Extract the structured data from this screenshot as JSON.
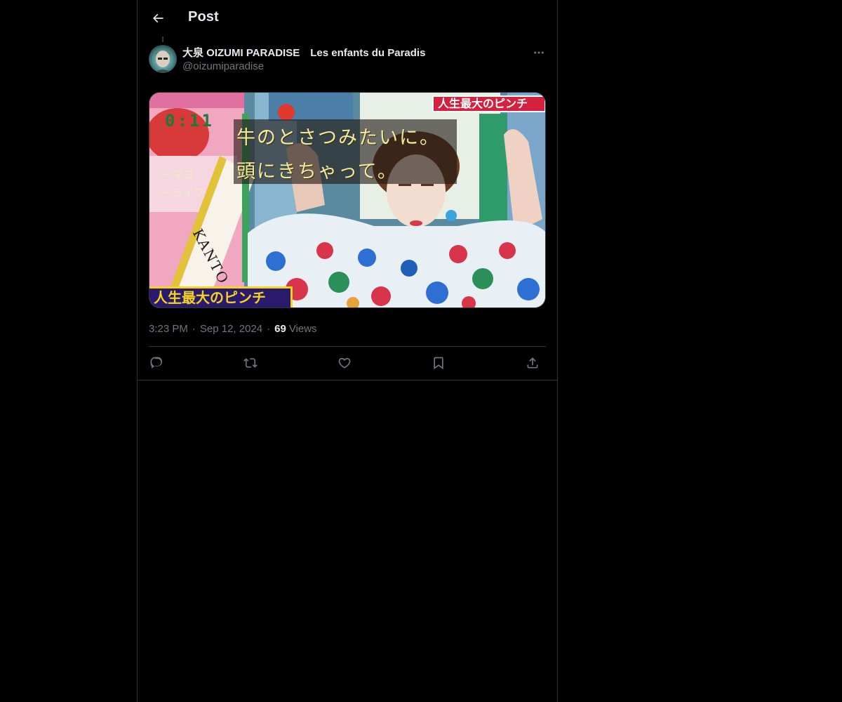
{
  "header": {
    "title": "Post",
    "back_icon": "arrow-left-icon"
  },
  "post": {
    "author": {
      "display_name": "大泉 OIZUMI PARADISE　Les enfants du Paradis",
      "handle": "@oizumiparadise",
      "avatar_icon": "avatar-photo"
    },
    "more_icon": "ellipsis-icon",
    "media": {
      "timer": "0:11",
      "caption_lines": [
        "牛のとさつみたいに。",
        "頭にきちゃって。"
      ],
      "banner_top": "人生最大のピンチ",
      "banner_bottom": "人生最大のピンチ",
      "side_labels": [
        "ーマヨ",
        "ーライフ"
      ],
      "sash_text": "KANTO"
    },
    "time": "3:23 PM",
    "separator": "·",
    "date": "Sep 12, 2024",
    "views_count": "69",
    "views_label": "Views"
  },
  "actions": [
    {
      "name": "reply-button",
      "icon": "reply-icon"
    },
    {
      "name": "repost-button",
      "icon": "repost-icon"
    },
    {
      "name": "like-button",
      "icon": "heart-icon"
    },
    {
      "name": "bookmark-button",
      "icon": "bookmark-icon"
    },
    {
      "name": "share-button",
      "icon": "share-icon"
    }
  ],
  "colors": {
    "background": "#000000",
    "text_primary": "#e7e9ea",
    "text_secondary": "#71767b",
    "border": "#2f3336"
  }
}
